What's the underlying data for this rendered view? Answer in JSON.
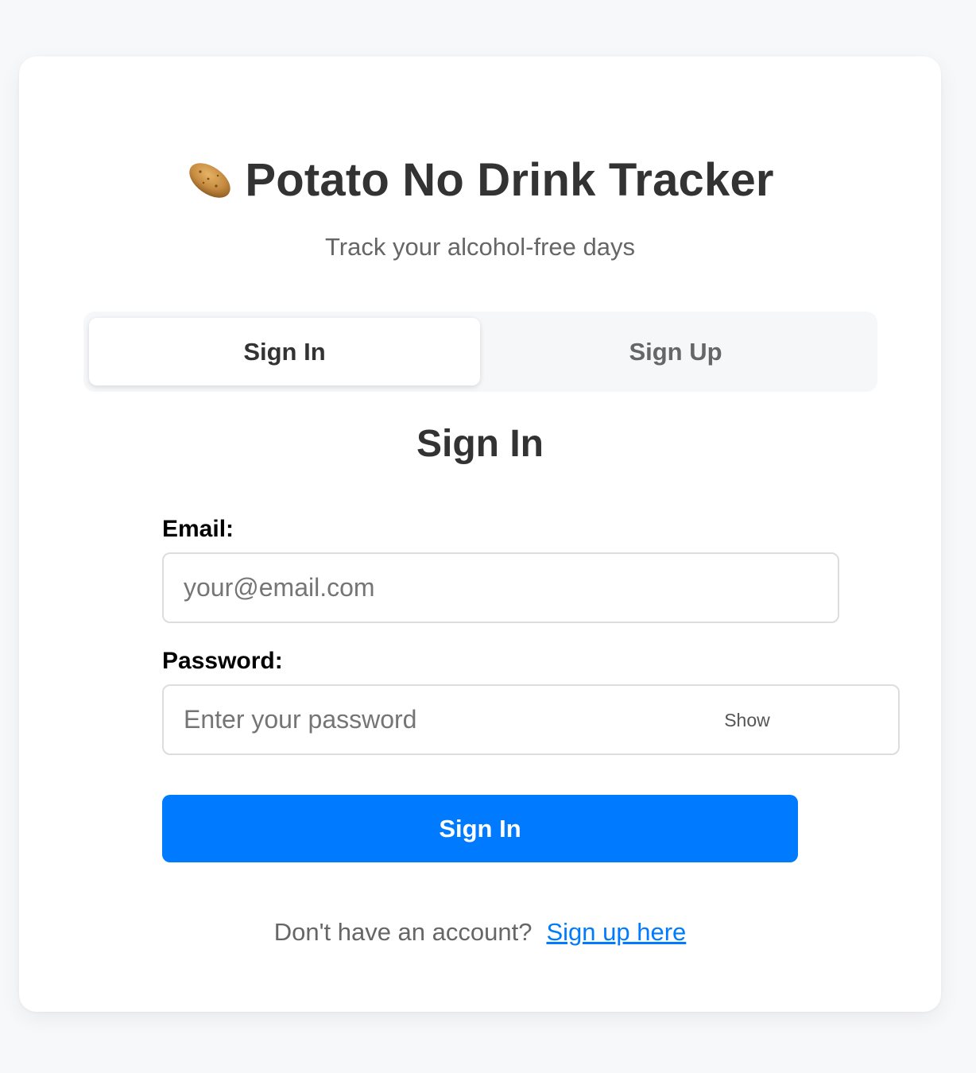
{
  "header": {
    "icon": "potato-icon",
    "title": "Potato No Drink Tracker",
    "subtitle": "Track your alcohol-free days"
  },
  "tabs": [
    {
      "label": "Sign In",
      "active": true
    },
    {
      "label": "Sign Up",
      "active": false
    }
  ],
  "form": {
    "heading": "Sign In",
    "email_label": "Email:",
    "email_value": "",
    "email_placeholder": "your@email.com",
    "password_label": "Password:",
    "password_value": "",
    "password_placeholder": "Enter your password",
    "show_label": "Show",
    "submit_label": "Sign In"
  },
  "footer": {
    "prompt": "Don't have an account?",
    "link_label": "Sign up here"
  },
  "colors": {
    "primary": "#007bff",
    "heading": "#333333",
    "muted": "#666666",
    "background": "#f7f8fa"
  }
}
